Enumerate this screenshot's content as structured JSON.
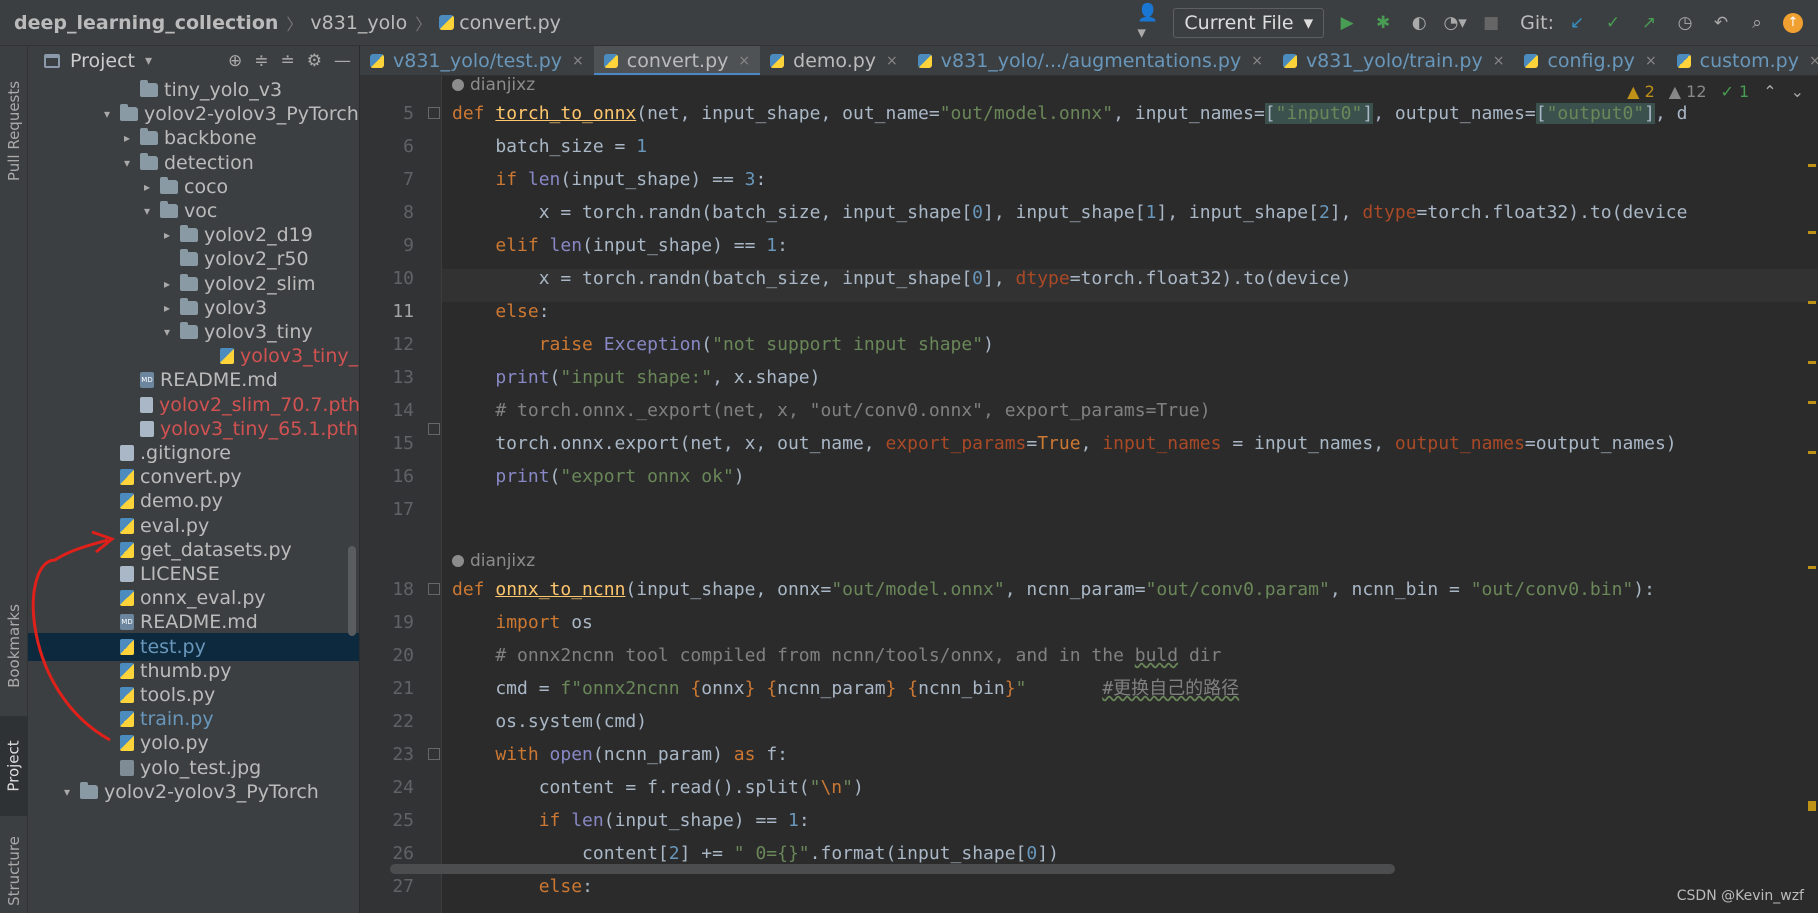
{
  "titlebar": {
    "project": "deep_learning_collection",
    "folder": "v831_yolo",
    "file": "convert.py",
    "run_config": "Current File",
    "git_label": "Git:"
  },
  "left_strip": {
    "pull_requests": "Pull Requests",
    "bookmarks": "Bookmarks",
    "project": "Project",
    "structure": "Structure"
  },
  "project_panel": {
    "title": "Project",
    "tree": [
      {
        "label": "tiny_yolo_v3",
        "kind": "folder",
        "arrow": "",
        "indent": 5,
        "color": ""
      },
      {
        "label": "yolov2-yolov3_PyTorch",
        "kind": "folder",
        "arrow": "▾",
        "indent": 4,
        "color": ""
      },
      {
        "label": "backbone",
        "kind": "folder",
        "arrow": "▸",
        "indent": 5,
        "color": ""
      },
      {
        "label": "detection",
        "kind": "folder",
        "arrow": "▾",
        "indent": 5,
        "color": ""
      },
      {
        "label": "coco",
        "kind": "folder",
        "arrow": "▸",
        "indent": 6,
        "color": ""
      },
      {
        "label": "voc",
        "kind": "folder",
        "arrow": "▾",
        "indent": 6,
        "color": ""
      },
      {
        "label": "yolov2_d19",
        "kind": "folder",
        "arrow": "▸",
        "indent": 7,
        "color": ""
      },
      {
        "label": "yolov2_r50",
        "kind": "folder",
        "arrow": "",
        "indent": 7,
        "color": ""
      },
      {
        "label": "yolov2_slim",
        "kind": "folder",
        "arrow": "▸",
        "indent": 7,
        "color": ""
      },
      {
        "label": "yolov3",
        "kind": "folder",
        "arrow": "▸",
        "indent": 7,
        "color": ""
      },
      {
        "label": "yolov3_tiny",
        "kind": "folder",
        "arrow": "▾",
        "indent": 7,
        "color": ""
      },
      {
        "label": "yolov3_tiny_",
        "kind": "py",
        "arrow": "",
        "indent": 9,
        "color": "red"
      },
      {
        "label": "README.md",
        "kind": "md",
        "arrow": "",
        "indent": 5,
        "color": ""
      },
      {
        "label": "yolov2_slim_70.7.pth",
        "kind": "txt",
        "arrow": "",
        "indent": 5,
        "color": "red"
      },
      {
        "label": "yolov3_tiny_65.1.pth",
        "kind": "txt",
        "arrow": "",
        "indent": 5,
        "color": "red"
      },
      {
        "label": ".gitignore",
        "kind": "txt",
        "arrow": "",
        "indent": 4,
        "color": ""
      },
      {
        "label": "convert.py",
        "kind": "py",
        "arrow": "",
        "indent": 4,
        "color": ""
      },
      {
        "label": "demo.py",
        "kind": "py",
        "arrow": "",
        "indent": 4,
        "color": ""
      },
      {
        "label": "eval.py",
        "kind": "py",
        "arrow": "",
        "indent": 4,
        "color": ""
      },
      {
        "label": "get_datasets.py",
        "kind": "py",
        "arrow": "",
        "indent": 4,
        "color": ""
      },
      {
        "label": "LICENSE",
        "kind": "txt",
        "arrow": "",
        "indent": 4,
        "color": ""
      },
      {
        "label": "onnx_eval.py",
        "kind": "py",
        "arrow": "",
        "indent": 4,
        "color": ""
      },
      {
        "label": "README.md",
        "kind": "md",
        "arrow": "",
        "indent": 4,
        "color": ""
      },
      {
        "label": "test.py",
        "kind": "py",
        "arrow": "",
        "indent": 4,
        "color": "blue",
        "selected": true
      },
      {
        "label": "thumb.py",
        "kind": "py",
        "arrow": "",
        "indent": 4,
        "color": ""
      },
      {
        "label": "tools.py",
        "kind": "py",
        "arrow": "",
        "indent": 4,
        "color": ""
      },
      {
        "label": "train.py",
        "kind": "py",
        "arrow": "",
        "indent": 4,
        "color": "blue"
      },
      {
        "label": "yolo.py",
        "kind": "py",
        "arrow": "",
        "indent": 4,
        "color": ""
      },
      {
        "label": "yolo_test.jpg",
        "kind": "jpg",
        "arrow": "",
        "indent": 4,
        "color": ""
      },
      {
        "label": "yolov2-yolov3_PyTorch",
        "kind": "folder",
        "arrow": "▾",
        "indent": 2,
        "color": ""
      }
    ]
  },
  "tabs": [
    {
      "label": "v831_yolo/test.py",
      "active": false,
      "color": "blue"
    },
    {
      "label": "convert.py",
      "active": true,
      "color": "white"
    },
    {
      "label": "demo.py",
      "active": false,
      "color": "white"
    },
    {
      "label": "v831_yolo/.../augmentations.py",
      "active": false,
      "color": "blue"
    },
    {
      "label": "v831_yolo/train.py",
      "active": false,
      "color": "blue"
    },
    {
      "label": "config.py",
      "active": false,
      "color": "blue"
    },
    {
      "label": "custom.py",
      "active": false,
      "color": "blue"
    }
  ],
  "inspections": {
    "warnings_a": "2",
    "warnings_b": "12",
    "ok": "1"
  },
  "editor": {
    "author_1": "dianjixz",
    "author_2": "dianjixz",
    "line_numbers": [
      "5",
      "6",
      "7",
      "8",
      "9",
      "10",
      "11",
      "12",
      "13",
      "14",
      "15",
      "16",
      "17",
      "18",
      "19",
      "20",
      "21",
      "22",
      "23",
      "24",
      "25",
      "26",
      "27"
    ],
    "current_line": "11"
  },
  "watermark": "CSDN @Kevin_wzf",
  "colors": {
    "keyword": "#cc7832",
    "string": "#6a8759",
    "number": "#6897bb",
    "comment": "#808080",
    "function": "#ffc66d",
    "param": "#aa4926",
    "annotation_arrow": "#e0201a"
  }
}
